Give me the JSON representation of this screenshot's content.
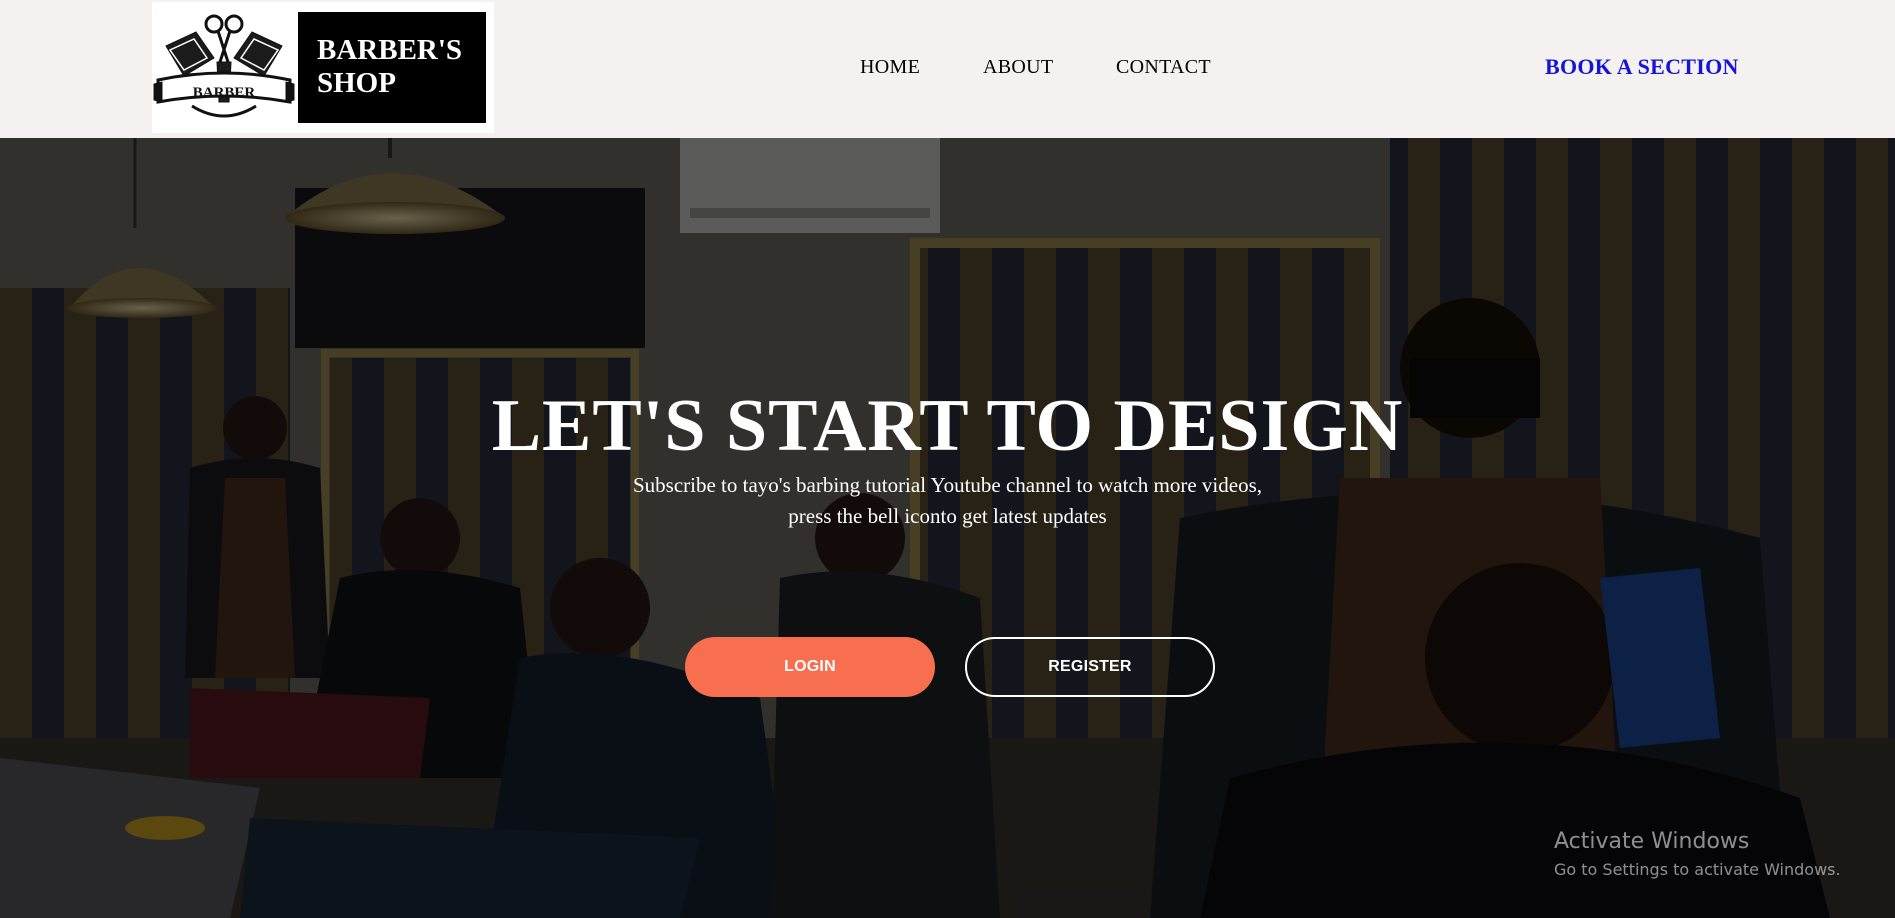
{
  "header": {
    "logo": {
      "emblem_text": "BARBER",
      "title_line1": "BARBER'S",
      "title_line2": "SHOP"
    },
    "nav": {
      "home": "HOME",
      "about": "ABOUT",
      "contact": "CONTACT"
    },
    "cta": "BOOK A SECTION",
    "colors": {
      "header_bg": "#f4f1f0",
      "cta_color": "#1515d8"
    }
  },
  "hero": {
    "title": "LET'S START TO DESIGN",
    "subtitle": "Subscribe to tayo's barbing tutorial Youtube channel to watch more videos, press the bell iconto get latest updates",
    "buttons": {
      "login": "LOGIN",
      "register": "REGISTER"
    },
    "colors": {
      "login_bg": "#f76f4f"
    }
  },
  "watermark": {
    "title": "Activate Windows",
    "subtitle": "Go to Settings to activate Windows."
  }
}
